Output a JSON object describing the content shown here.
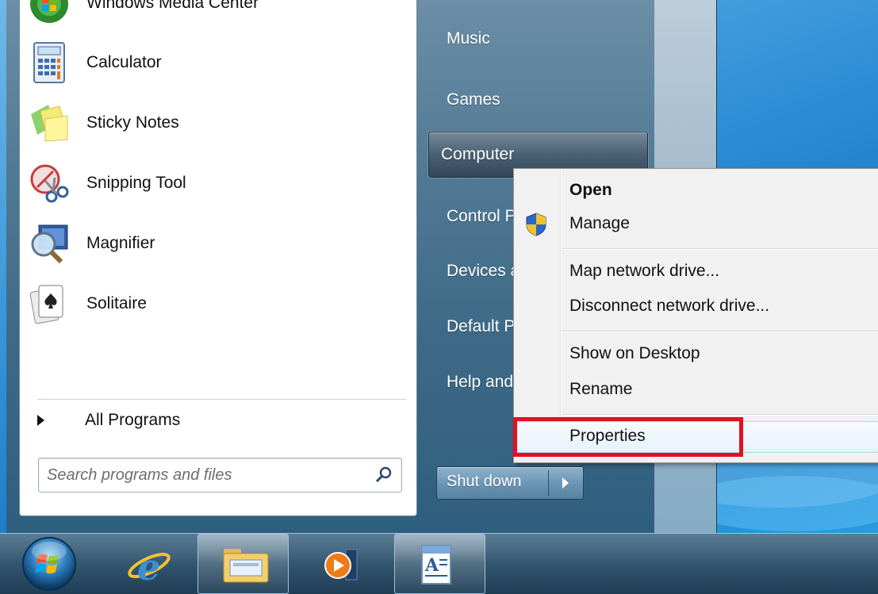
{
  "start_menu": {
    "programs": [
      {
        "label": "Windows Media Center",
        "icon": "windows-media-center-icon"
      },
      {
        "label": "Calculator",
        "icon": "calculator-icon"
      },
      {
        "label": "Sticky Notes",
        "icon": "sticky-notes-icon"
      },
      {
        "label": "Snipping Tool",
        "icon": "snipping-tool-icon"
      },
      {
        "label": "Magnifier",
        "icon": "magnifier-icon"
      },
      {
        "label": "Solitaire",
        "icon": "solitaire-icon"
      }
    ],
    "all_programs_label": "All Programs",
    "search": {
      "placeholder": "Search programs and files",
      "value": ""
    },
    "right_items": [
      {
        "label": "Music"
      },
      {
        "label": "Games"
      },
      {
        "label": "Computer"
      },
      {
        "label": "Control Panel"
      },
      {
        "label": "Devices and Printers"
      },
      {
        "label": "Default Programs"
      },
      {
        "label": "Help and Support"
      }
    ],
    "shutdown_label": "Shut down"
  },
  "context_menu": {
    "items": [
      {
        "label": "Open",
        "bold": true
      },
      {
        "label": "Manage",
        "icon": "uac-shield-icon"
      },
      {
        "label": "Map network drive..."
      },
      {
        "label": "Disconnect network drive..."
      },
      {
        "label": "Show on Desktop"
      },
      {
        "label": "Rename"
      },
      {
        "label": "Properties",
        "highlighted": true
      }
    ],
    "highlight_color": "#e3111f"
  },
  "taskbar": {
    "items": [
      {
        "icon": "start-orb-icon"
      },
      {
        "icon": "internet-explorer-icon"
      },
      {
        "icon": "windows-explorer-icon",
        "active": true
      },
      {
        "icon": "media-player-icon"
      },
      {
        "icon": "wordpad-icon",
        "active": true
      }
    ]
  }
}
